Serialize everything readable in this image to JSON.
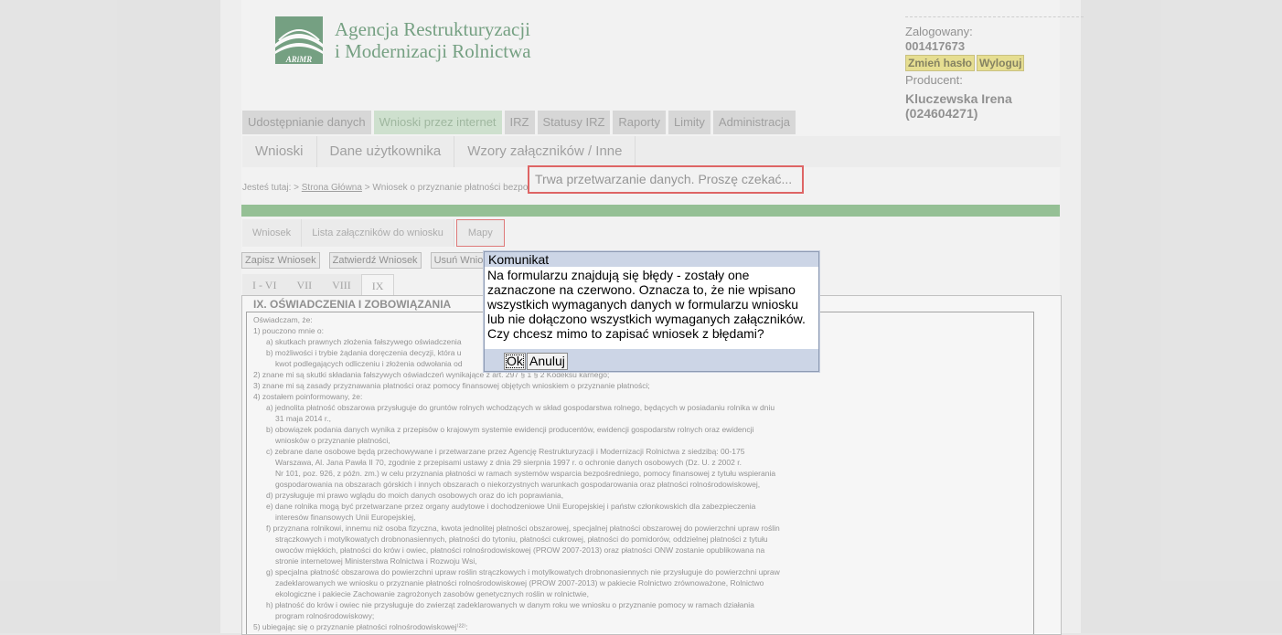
{
  "header": {
    "agency_line1": "Agencja Restrukturyzacji",
    "agency_line2": "i Modernizacji Rolnictwa",
    "logo_text": "ARiMR",
    "logged_label": "Zalogowany:",
    "user_id": "001417673",
    "change_password": "Zmień hasło",
    "logout": "Wyloguj",
    "producer_label": "Producent:",
    "producer_name": "Kluczewska Irena (024604271)"
  },
  "top_tabs": [
    "Udostępnianie danych",
    "Wnioski przez internet",
    "IRZ",
    "Statusy IRZ",
    "Raporty",
    "Limity",
    "Administracja"
  ],
  "sub_nav": [
    "Wnioski",
    "Dane użytkownika",
    "Wzory załączników / Inne"
  ],
  "breadcrumb": {
    "prefix": "Jesteś tutaj:",
    "sep1": ">",
    "home": "Strona Główna",
    "sep2": ">",
    "current": "Wniosek o przyznanie płatności bezpośre"
  },
  "processing_msg": "Trwa przetwarzanie danych. Proszę czekać...",
  "wniosek_tabs": [
    "Wniosek",
    "Lista załączników do wniosku",
    "Mapy"
  ],
  "actions": [
    "Zapisz Wniosek",
    "Zatwierdź Wniosek",
    "Usuń Wniosek"
  ],
  "sections": [
    "I - VI",
    "VII",
    "VIII",
    "IX"
  ],
  "content": {
    "title": "IX. OŚWIADCZENIA I ZOBOWIĄZANIA",
    "lines": [
      {
        "indent": 0,
        "text": "Oświadczam, że:"
      },
      {
        "indent": 0,
        "text": "1) pouczono mnie o:"
      },
      {
        "indent": 1,
        "text": "a) skutkach prawnych złożenia fałszywego oświadczenia"
      },
      {
        "indent": 1,
        "text": "b) możliwości i trybie żądania doręczenia decyzji, która u"
      },
      {
        "indent": 2,
        "text": "kwot podlegających odliczeniu i złożenia odwołania od"
      },
      {
        "indent": 0,
        "text": "2) znane mi są skutki składania fałszywych oświadczeń wynikające z art. 297 § 1 § 2 Kodeksu karnego;"
      },
      {
        "indent": 0,
        "text": "3) znane mi są zasady przyznawania płatności oraz pomocy finansowej objętych wnioskiem o przyznanie płatności;"
      },
      {
        "indent": 0,
        "text": "4) zostałem poinformowany, że:"
      },
      {
        "indent": 1,
        "text": "a) jednolita płatność obszarowa przysługuje do gruntów rolnych wchodzących w skład gospodarstwa rolnego, będących w posiadaniu rolnika w dniu"
      },
      {
        "indent": 2,
        "text": "31 maja 2014 r.,"
      },
      {
        "indent": 1,
        "text": "b) obowiązek podania danych wynika z przepisów o krajowym systemie ewidencji producentów, ewidencji gospodarstw rolnych oraz ewidencji"
      },
      {
        "indent": 2,
        "text": "wniosków o przyznanie płatności,"
      },
      {
        "indent": 1,
        "text": "c) zebrane dane osobowe będą przechowywane i przetwarzane przez Agencję Restrukturyzacji i Modernizacji Rolnictwa z siedzibą: 00-175"
      },
      {
        "indent": 2,
        "text": "Warszawa, Al. Jana Pawła II 70, zgodnie z przepisami ustawy z dnia 29 sierpnia 1997 r. o ochronie danych osobowych (Dz. U. z 2002 r."
      },
      {
        "indent": 2,
        "text": "Nr 101, poz. 926, z późn. zm.) w celu przyznania płatności w ramach systemów wsparcia bezpośredniego, pomocy finansowej z tytułu wspierania"
      },
      {
        "indent": 2,
        "text": "gospodarowania na obszarach górskich i innych obszarach o niekorzystnych warunkach gospodarowania oraz płatności rolnośrodowiskowej,"
      },
      {
        "indent": 1,
        "text": "d) przysługuje mi prawo wglądu do moich danych osobowych oraz do ich poprawiania,"
      },
      {
        "indent": 1,
        "text": "e) dane rolnika mogą być przetwarzane przez organy audytowe i dochodzeniowe Unii Europejskiej i państw członkowskich dla zabezpieczenia"
      },
      {
        "indent": 2,
        "text": "interesów finansowych Unii Europejskiej,"
      },
      {
        "indent": 1,
        "text": "f) przyznana rolnikowi, innemu niż osoba fizyczna, kwota jednolitej płatności obszarowej, specjalnej płatności obszarowej do powierzchni upraw roślin"
      },
      {
        "indent": 2,
        "text": "strączkowych i motylkowatych drobnonasiennych, płatności do tytoniu, płatności cukrowej, płatności do pomidorów, oddzielnej płatności z tytułu"
      },
      {
        "indent": 2,
        "text": "owoców miękkich, płatności do krów i owiec, płatności rolnośrodowiskowej (PROW 2007-2013) oraz płatności ONW zostanie opublikowana na"
      },
      {
        "indent": 2,
        "text": "stronie internetowej Ministerstwa Rolnictwa i Rozwoju Wsi,"
      },
      {
        "indent": 1,
        "text": "g) specjalna płatność obszarowa do powierzchni upraw roślin strączkowych i motylkowatych drobnonasiennych nie przysługuje do powierzchni upraw"
      },
      {
        "indent": 2,
        "text": "zadeklarowanych we wniosku o przyznanie płatności rolnośrodowiskowej (PROW 2007-2013) w pakiecie Rolnictwo zrównoważone, Rolnictwo"
      },
      {
        "indent": 2,
        "text": "ekologiczne i pakiecie Zachowanie zagrożonych zasobów genetycznych roślin w rolnictwie,"
      },
      {
        "indent": 1,
        "text": "h) płatność do krów i owiec nie przysługuje do zwierząt zadeklarowanych w danym roku we wniosku o przyznanie pomocy w ramach działania"
      },
      {
        "indent": 2,
        "text": "program rolnośrodowiskowy;"
      },
      {
        "indent": 0,
        "text": "5) ubiegając się o przyznanie płatności rolnośrodowiskowej⁽²²⁾:"
      }
    ]
  },
  "modal": {
    "title": "Komunikat",
    "line1": "Na formularzu znajdują się błędy - zostały one",
    "line2": "zaznaczone na czerwono. Oznacza to, że nie wpisano",
    "line3": "wszystkich wymaganych danych w formularzu wniosku",
    "line4": "lub nie dołączono wszystkich wymaganych załączników.",
    "line5": "Czy chcesz mimo to zapisać wniosek z błędami?",
    "ok": "Ok",
    "cancel": "Anuluj"
  },
  "colors": {
    "accent_green": "#8fbf8f",
    "error_red": "#e05a5a",
    "modal_header": "#ccd5e6",
    "user_button": "#e9e08b"
  }
}
